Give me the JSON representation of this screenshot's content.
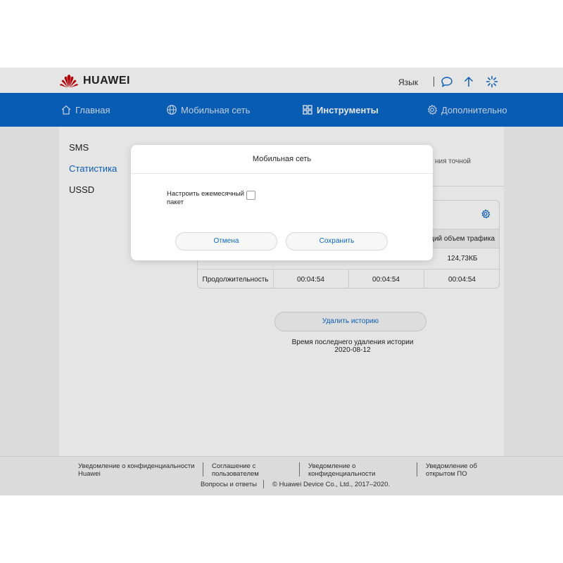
{
  "brand": {
    "name": "HUAWEI",
    "color": "#c7000b"
  },
  "header": {
    "language_label": "Язык",
    "icons": [
      "chat-icon",
      "upload-icon",
      "loading-icon"
    ]
  },
  "nav": {
    "accent": "#0b67c9",
    "items": [
      {
        "label": "Главная",
        "icon": "home-icon"
      },
      {
        "label": "Мобильная сеть",
        "icon": "globe-icon"
      },
      {
        "label": "Инструменты",
        "icon": "apps-icon",
        "active": true
      },
      {
        "label": "Дополнительно",
        "icon": "gear-icon"
      }
    ]
  },
  "sidebar": {
    "items": [
      {
        "label": "SMS"
      },
      {
        "label": "Статистика",
        "active": true
      },
      {
        "label": "USSD"
      }
    ]
  },
  "main": {
    "hint_fragment": "ния точной",
    "table": {
      "total_header": "бщий объем трафика",
      "total_row_value": "124,73КБ",
      "duration_label": "Продолжительность",
      "duration_values": [
        "00:04:54",
        "00:04:54",
        "00:04:54"
      ]
    },
    "delete_button": "Удалить историю",
    "last_delete_label": "Время последнего удаления истории",
    "last_delete_date": "2020-08-12"
  },
  "footer": {
    "links": [
      "Уведомление о конфиденциальности Huawei",
      "Соглашение с пользователем",
      "Уведомление о конфиденциальности",
      "Уведомление об открытом ПО"
    ],
    "faq": "Вопросы и ответы",
    "copyright": "© Huawei Device Co., Ltd., 2017–2020."
  },
  "modal": {
    "title": "Мобильная сеть",
    "checkbox_label": "Настроить ежемесячный пакет",
    "checkbox_checked": false,
    "cancel_label": "Отмена",
    "save_label": "Сохранить"
  }
}
